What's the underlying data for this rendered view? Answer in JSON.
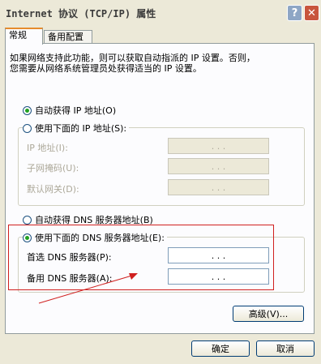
{
  "window": {
    "title": "Internet 协议 (TCP/IP) 属性",
    "help_glyph": "?",
    "close_glyph": "✕"
  },
  "tabs": [
    {
      "label": "常规",
      "active": true
    },
    {
      "label": "备用配置",
      "active": false
    }
  ],
  "intro": {
    "line1": "如果网络支持此功能，则可以获取自动指派的 IP 设置。否则，",
    "line2": "您需要从网络系统管理员处获得适当的 IP 设置。"
  },
  "ip": {
    "auto_label": "自动获得 IP 地址(O)",
    "auto_selected": true,
    "manual_label": "使用下面的 IP 地址(S):",
    "manual_selected": false,
    "fields": [
      {
        "label": "IP 地址(I):",
        "value": ".   .   ."
      },
      {
        "label": "子网掩码(U):",
        "value": ".   .   ."
      },
      {
        "label": "默认网关(D):",
        "value": ".   .   ."
      }
    ]
  },
  "dns": {
    "auto_label": "自动获得 DNS 服务器地址(B)",
    "auto_selected": false,
    "manual_label": "使用下面的 DNS 服务器地址(E):",
    "manual_selected": true,
    "fields": [
      {
        "label": "首选 DNS 服务器(P):",
        "value": ".   .   ."
      },
      {
        "label": "备用 DNS 服务器(A):",
        "value": ".   .   ."
      }
    ]
  },
  "buttons": {
    "advanced": "高级(V)...",
    "ok": "确定",
    "cancel": "取消"
  },
  "colors": {
    "annotation": "#d0201f",
    "selected_radio": "#21a121"
  }
}
